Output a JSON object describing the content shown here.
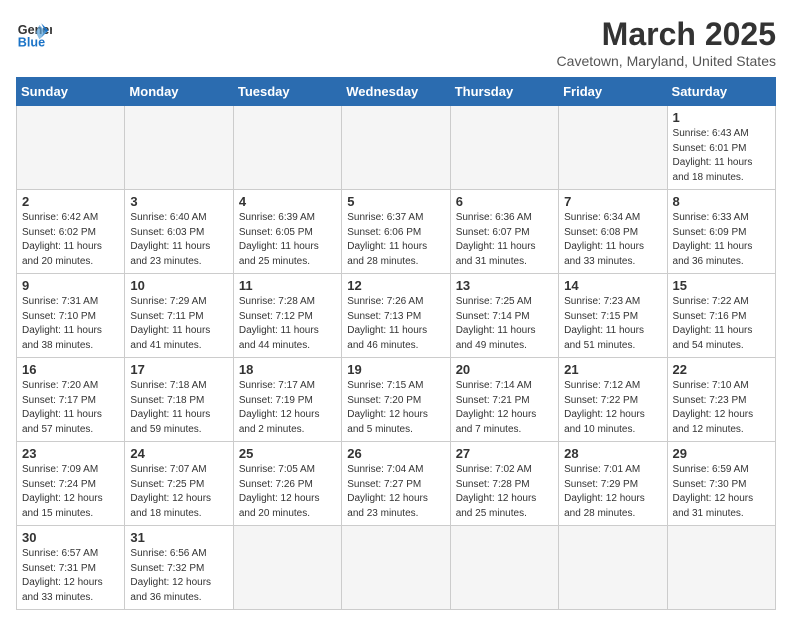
{
  "logo": {
    "line1": "General",
    "line2": "Blue"
  },
  "title": "March 2025",
  "subtitle": "Cavetown, Maryland, United States",
  "days_of_week": [
    "Sunday",
    "Monday",
    "Tuesday",
    "Wednesday",
    "Thursday",
    "Friday",
    "Saturday"
  ],
  "weeks": [
    [
      {
        "day": "",
        "info": ""
      },
      {
        "day": "",
        "info": ""
      },
      {
        "day": "",
        "info": ""
      },
      {
        "day": "",
        "info": ""
      },
      {
        "day": "",
        "info": ""
      },
      {
        "day": "",
        "info": ""
      },
      {
        "day": "1",
        "info": "Sunrise: 6:43 AM\nSunset: 6:01 PM\nDaylight: 11 hours\nand 18 minutes."
      }
    ],
    [
      {
        "day": "2",
        "info": "Sunrise: 6:42 AM\nSunset: 6:02 PM\nDaylight: 11 hours\nand 20 minutes."
      },
      {
        "day": "3",
        "info": "Sunrise: 6:40 AM\nSunset: 6:03 PM\nDaylight: 11 hours\nand 23 minutes."
      },
      {
        "day": "4",
        "info": "Sunrise: 6:39 AM\nSunset: 6:05 PM\nDaylight: 11 hours\nand 25 minutes."
      },
      {
        "day": "5",
        "info": "Sunrise: 6:37 AM\nSunset: 6:06 PM\nDaylight: 11 hours\nand 28 minutes."
      },
      {
        "day": "6",
        "info": "Sunrise: 6:36 AM\nSunset: 6:07 PM\nDaylight: 11 hours\nand 31 minutes."
      },
      {
        "day": "7",
        "info": "Sunrise: 6:34 AM\nSunset: 6:08 PM\nDaylight: 11 hours\nand 33 minutes."
      },
      {
        "day": "8",
        "info": "Sunrise: 6:33 AM\nSunset: 6:09 PM\nDaylight: 11 hours\nand 36 minutes."
      }
    ],
    [
      {
        "day": "9",
        "info": "Sunrise: 7:31 AM\nSunset: 7:10 PM\nDaylight: 11 hours\nand 38 minutes."
      },
      {
        "day": "10",
        "info": "Sunrise: 7:29 AM\nSunset: 7:11 PM\nDaylight: 11 hours\nand 41 minutes."
      },
      {
        "day": "11",
        "info": "Sunrise: 7:28 AM\nSunset: 7:12 PM\nDaylight: 11 hours\nand 44 minutes."
      },
      {
        "day": "12",
        "info": "Sunrise: 7:26 AM\nSunset: 7:13 PM\nDaylight: 11 hours\nand 46 minutes."
      },
      {
        "day": "13",
        "info": "Sunrise: 7:25 AM\nSunset: 7:14 PM\nDaylight: 11 hours\nand 49 minutes."
      },
      {
        "day": "14",
        "info": "Sunrise: 7:23 AM\nSunset: 7:15 PM\nDaylight: 11 hours\nand 51 minutes."
      },
      {
        "day": "15",
        "info": "Sunrise: 7:22 AM\nSunset: 7:16 PM\nDaylight: 11 hours\nand 54 minutes."
      }
    ],
    [
      {
        "day": "16",
        "info": "Sunrise: 7:20 AM\nSunset: 7:17 PM\nDaylight: 11 hours\nand 57 minutes."
      },
      {
        "day": "17",
        "info": "Sunrise: 7:18 AM\nSunset: 7:18 PM\nDaylight: 11 hours\nand 59 minutes."
      },
      {
        "day": "18",
        "info": "Sunrise: 7:17 AM\nSunset: 7:19 PM\nDaylight: 12 hours\nand 2 minutes."
      },
      {
        "day": "19",
        "info": "Sunrise: 7:15 AM\nSunset: 7:20 PM\nDaylight: 12 hours\nand 5 minutes."
      },
      {
        "day": "20",
        "info": "Sunrise: 7:14 AM\nSunset: 7:21 PM\nDaylight: 12 hours\nand 7 minutes."
      },
      {
        "day": "21",
        "info": "Sunrise: 7:12 AM\nSunset: 7:22 PM\nDaylight: 12 hours\nand 10 minutes."
      },
      {
        "day": "22",
        "info": "Sunrise: 7:10 AM\nSunset: 7:23 PM\nDaylight: 12 hours\nand 12 minutes."
      }
    ],
    [
      {
        "day": "23",
        "info": "Sunrise: 7:09 AM\nSunset: 7:24 PM\nDaylight: 12 hours\nand 15 minutes."
      },
      {
        "day": "24",
        "info": "Sunrise: 7:07 AM\nSunset: 7:25 PM\nDaylight: 12 hours\nand 18 minutes."
      },
      {
        "day": "25",
        "info": "Sunrise: 7:05 AM\nSunset: 7:26 PM\nDaylight: 12 hours\nand 20 minutes."
      },
      {
        "day": "26",
        "info": "Sunrise: 7:04 AM\nSunset: 7:27 PM\nDaylight: 12 hours\nand 23 minutes."
      },
      {
        "day": "27",
        "info": "Sunrise: 7:02 AM\nSunset: 7:28 PM\nDaylight: 12 hours\nand 25 minutes."
      },
      {
        "day": "28",
        "info": "Sunrise: 7:01 AM\nSunset: 7:29 PM\nDaylight: 12 hours\nand 28 minutes."
      },
      {
        "day": "29",
        "info": "Sunrise: 6:59 AM\nSunset: 7:30 PM\nDaylight: 12 hours\nand 31 minutes."
      }
    ],
    [
      {
        "day": "30",
        "info": "Sunrise: 6:57 AM\nSunset: 7:31 PM\nDaylight: 12 hours\nand 33 minutes."
      },
      {
        "day": "31",
        "info": "Sunrise: 6:56 AM\nSunset: 7:32 PM\nDaylight: 12 hours\nand 36 minutes."
      },
      {
        "day": "",
        "info": ""
      },
      {
        "day": "",
        "info": ""
      },
      {
        "day": "",
        "info": ""
      },
      {
        "day": "",
        "info": ""
      },
      {
        "day": "",
        "info": ""
      }
    ]
  ]
}
